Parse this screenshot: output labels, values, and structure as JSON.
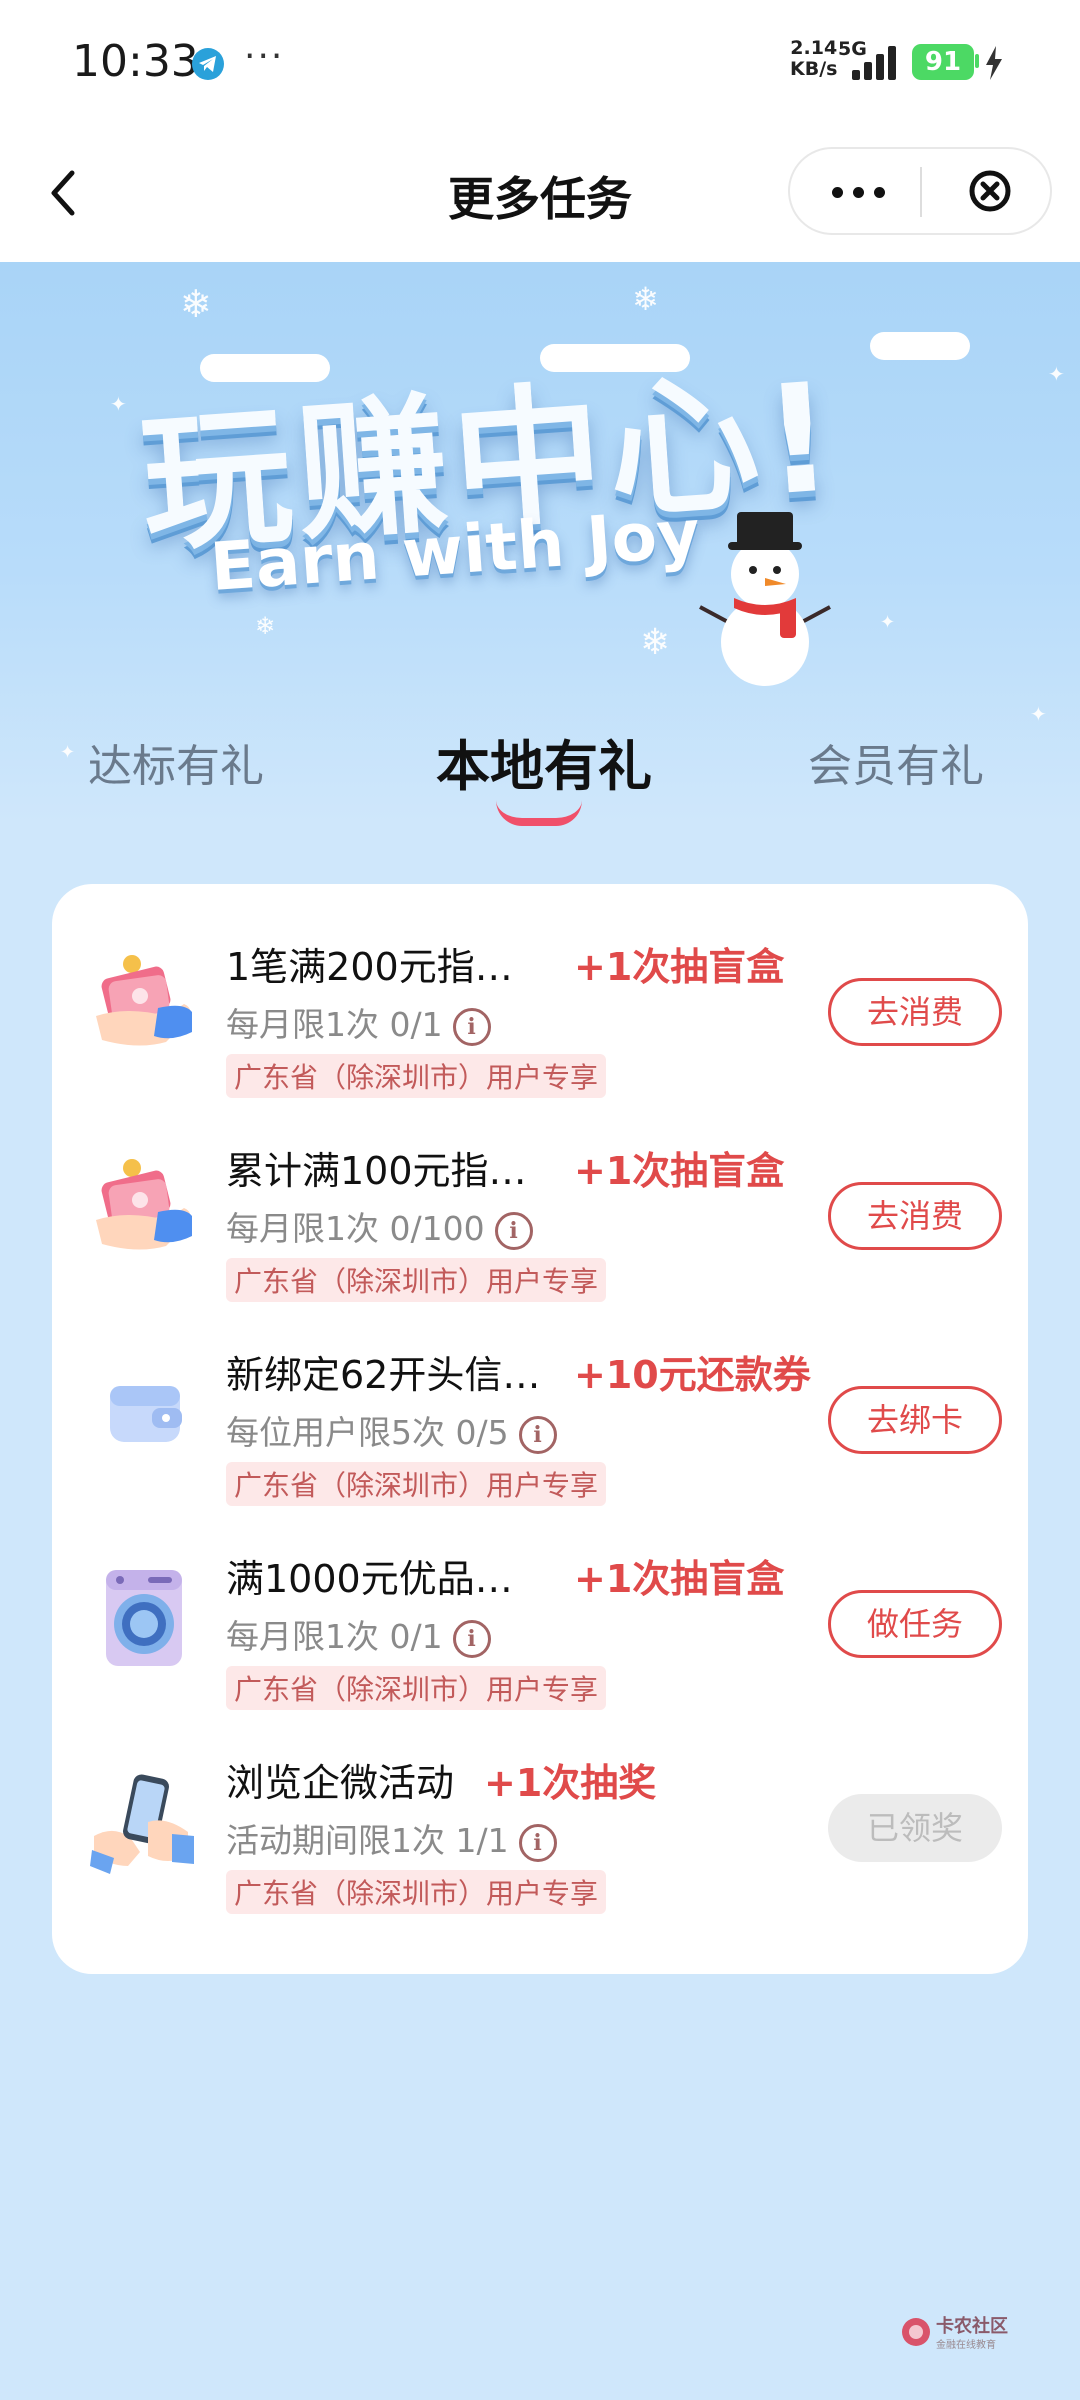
{
  "status_bar": {
    "time": "10:33",
    "dots": "···",
    "net_speed_value": "2.14",
    "net_speed_unit": "KB/s",
    "network": "5G",
    "battery": "91"
  },
  "nav": {
    "title": "更多任务"
  },
  "banner": {
    "title_cn": "玩赚中心!",
    "title_en": "Earn with Joy"
  },
  "tabs": [
    {
      "label": "达标有礼"
    },
    {
      "label": "本地有礼"
    },
    {
      "label": "会员有礼"
    }
  ],
  "tasks": [
    {
      "icon": "cash-hand-icon",
      "title": "1笔满200元指…",
      "reward": "+1次抽盲盒",
      "limit": "每月限1次  0/1",
      "tag": "广东省（除深圳市）用户专享",
      "button": "去消费"
    },
    {
      "icon": "cash-hand-icon",
      "title": "累计满100元指…",
      "reward": "+1次抽盲盒",
      "limit": "每月限1次  0/100",
      "tag": "广东省（除深圳市）用户专享",
      "button": "去消费"
    },
    {
      "icon": "wallet-icon",
      "title": "新绑定62开头信…",
      "reward": "+10元还款券",
      "limit": "每位用户限5次  0/5",
      "tag": "广东省（除深圳市）用户专享",
      "button": "去绑卡"
    },
    {
      "icon": "washing-machine-icon",
      "title": "满1000元优品…",
      "reward": "+1次抽盲盒",
      "limit": "每月限1次  0/1",
      "tag": "广东省（除深圳市）用户专享",
      "button": "做任务"
    },
    {
      "icon": "phone-hand-icon",
      "title": "浏览企微活动",
      "reward": "+1次抽奖",
      "limit": "活动期间限1次  1/1",
      "tag": "广东省（除深圳市）用户专享",
      "button": "已领奖"
    }
  ],
  "watermark": {
    "text": "卡农社区",
    "subtext": "金融在线教育"
  },
  "colors": {
    "accent_red": "#e04a4a",
    "banner_blue": "#a9d4f7",
    "page_bg": "#cfe7fb"
  }
}
